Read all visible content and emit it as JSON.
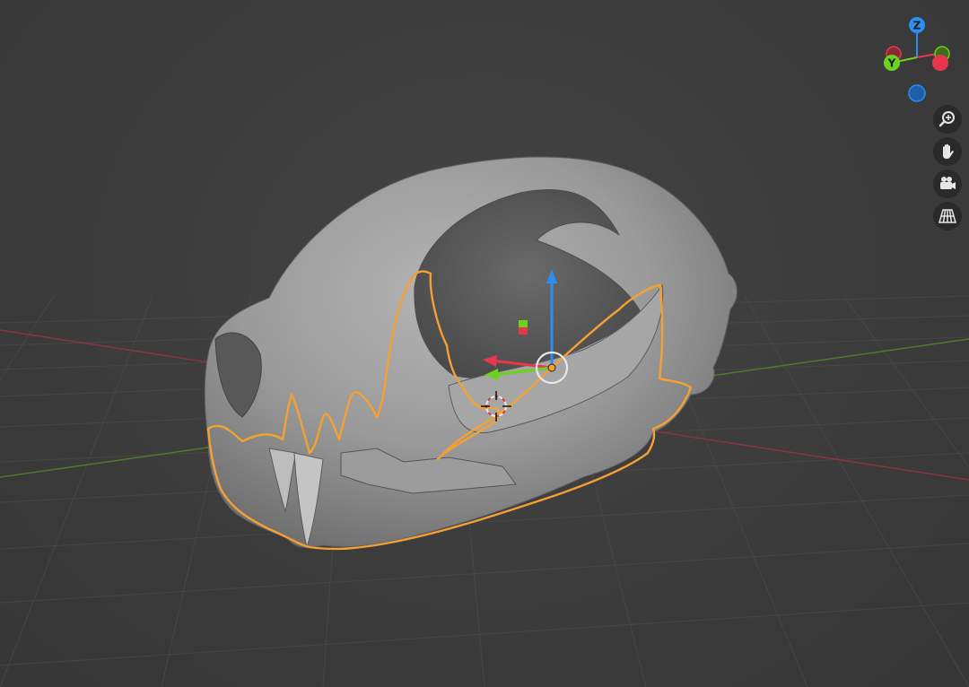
{
  "viewport": {
    "background": "#3d3d3d",
    "selection_outline_color": "#f5a033"
  },
  "axis_gizmo": {
    "z_label": "Z",
    "y_label": "Y",
    "x_color": "#e8374c",
    "y_color": "#6bd21e",
    "z_color": "#2c8ff0"
  },
  "nav_buttons": [
    {
      "name": "zoom",
      "icon": "magnifier-plus-icon"
    },
    {
      "name": "pan",
      "icon": "hand-icon"
    },
    {
      "name": "camera",
      "icon": "camera-icon"
    },
    {
      "name": "perspective",
      "icon": "grid-icon"
    }
  ],
  "transform_gizmo": {
    "x_color": "#e8374c",
    "y_color": "#6bd21e",
    "z_color": "#2c8ff0"
  }
}
